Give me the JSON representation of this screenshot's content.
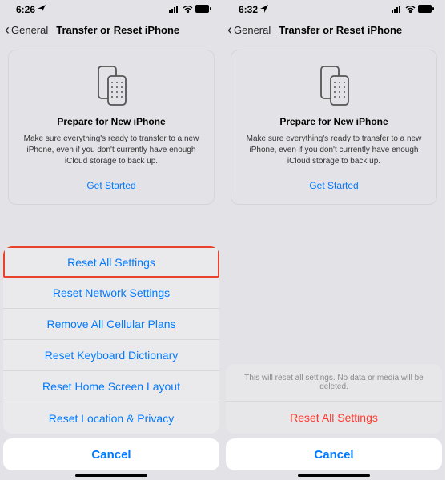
{
  "left": {
    "status": {
      "time": "6:26",
      "location_icon": true
    },
    "nav": {
      "back": "General",
      "title": "Transfer or Reset iPhone"
    },
    "card": {
      "title": "Prepare for New iPhone",
      "desc": "Make sure everything's ready to transfer to a new iPhone, even if you don't currently have enough iCloud storage to back up.",
      "cta": "Get Started"
    },
    "sheet": {
      "items": [
        "Reset All Settings",
        "Reset Network Settings",
        "Remove All Cellular Plans",
        "Reset Keyboard Dictionary",
        "Reset Home Screen Layout",
        "Reset Location & Privacy"
      ],
      "cancel": "Cancel"
    }
  },
  "right": {
    "status": {
      "time": "6:32"
    },
    "nav": {
      "back": "General",
      "title": "Transfer or Reset iPhone"
    },
    "card": {
      "title": "Prepare for New iPhone",
      "desc": "Make sure everything's ready to transfer to a new iPhone, even if you don't currently have enough iCloud storage to back up.",
      "cta": "Get Started"
    },
    "confirm": {
      "header": "This will reset all settings. No data or media will be deleted.",
      "action": "Reset All Settings",
      "cancel": "Cancel"
    }
  }
}
